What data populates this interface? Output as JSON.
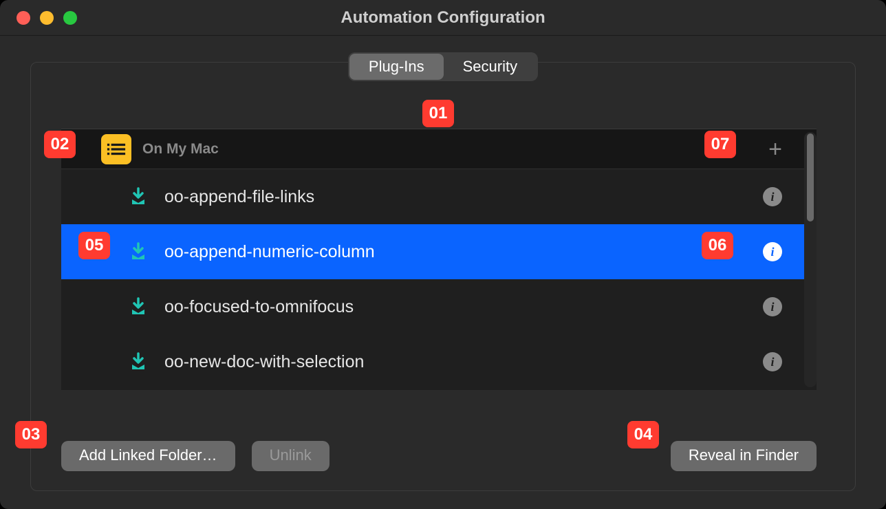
{
  "window": {
    "title": "Automation Configuration"
  },
  "tabs": {
    "plugins": "Plug-Ins",
    "security": "Security",
    "selected": "plugins"
  },
  "section": {
    "title": "On My Mac",
    "add_symbol": "+"
  },
  "plugins": [
    {
      "name": "oo-append-file-links",
      "selected": false
    },
    {
      "name": "oo-append-numeric-column",
      "selected": true
    },
    {
      "name": "oo-focused-to-omnifocus",
      "selected": false
    },
    {
      "name": "oo-new-doc-with-selection",
      "selected": false
    }
  ],
  "buttons": {
    "add_linked_folder": "Add Linked Folder…",
    "unlink": "Unlink",
    "reveal_in_finder": "Reveal in Finder"
  },
  "info_glyph": "i",
  "annotations": {
    "a01": "01",
    "a02": "02",
    "a03": "03",
    "a04": "04",
    "a05": "05",
    "a06": "06",
    "a07": "07"
  }
}
